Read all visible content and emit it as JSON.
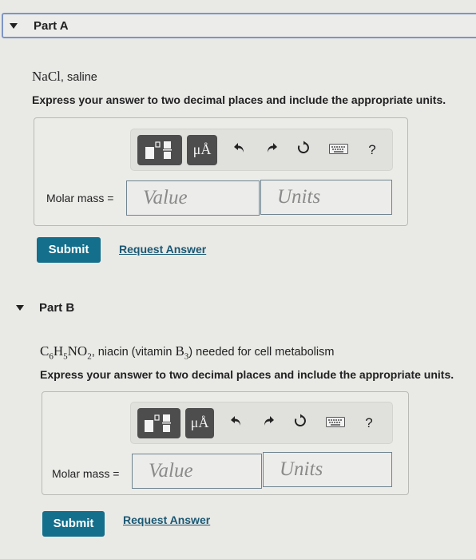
{
  "parts": [
    {
      "title": "Part A",
      "question_formula": "NaCl",
      "question_text": ", saline",
      "instructions": "Express your answer to two decimal places and include the appropriate units.",
      "field_label": "Molar mass =",
      "value_placeholder": "Value",
      "units_placeholder": "Units",
      "submit_label": "Submit",
      "request_label": "Request Answer"
    },
    {
      "title": "Part B",
      "question_formula_parts": [
        "C",
        "6",
        "H",
        "5",
        "NO",
        "2"
      ],
      "question_text_1": ", niacin (vitamin ",
      "question_formula_b": "B",
      "question_formula_b_sub": "3",
      "question_text_2": ") needed for cell metabolism",
      "instructions": "Express your answer to two decimal places and include the appropriate units.",
      "field_label": "Molar mass =",
      "value_placeholder": "Value",
      "units_placeholder": "Units",
      "submit_label": "Submit",
      "request_label": "Request Answer"
    }
  ],
  "toolbar": {
    "units_label": "μÅ",
    "help_label": "?",
    "icons": [
      "templates-icon",
      "units-icon",
      "undo-icon",
      "redo-icon",
      "reset-icon",
      "keyboard-icon",
      "help-icon"
    ]
  }
}
